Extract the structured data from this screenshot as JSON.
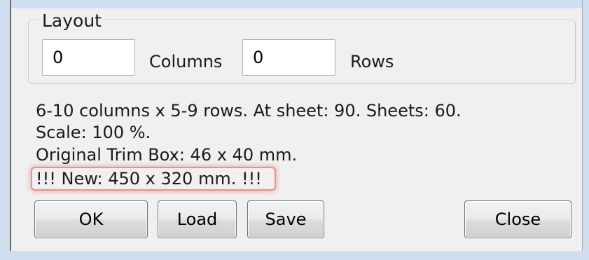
{
  "layout_group": {
    "title": "Layout",
    "columns_value": "0",
    "columns_label": "Columns",
    "rows_value": "0",
    "rows_label": "Rows"
  },
  "info": {
    "line1": "6-10 columns x 5-9 rows. At sheet: 90. Sheets: 60.",
    "line2": "Scale: 100 %.",
    "line3": "Original Trim Box: 46 x 40 mm.",
    "line4": "!!! New: 450 x 320 mm. !!!"
  },
  "buttons": {
    "ok": "OK",
    "load": "Load",
    "save": "Save",
    "close": "Close"
  },
  "colors": {
    "panel_background": "#f0f0f0",
    "window_frame": "#cfdff0",
    "highlight_border": "#f08c8c"
  }
}
